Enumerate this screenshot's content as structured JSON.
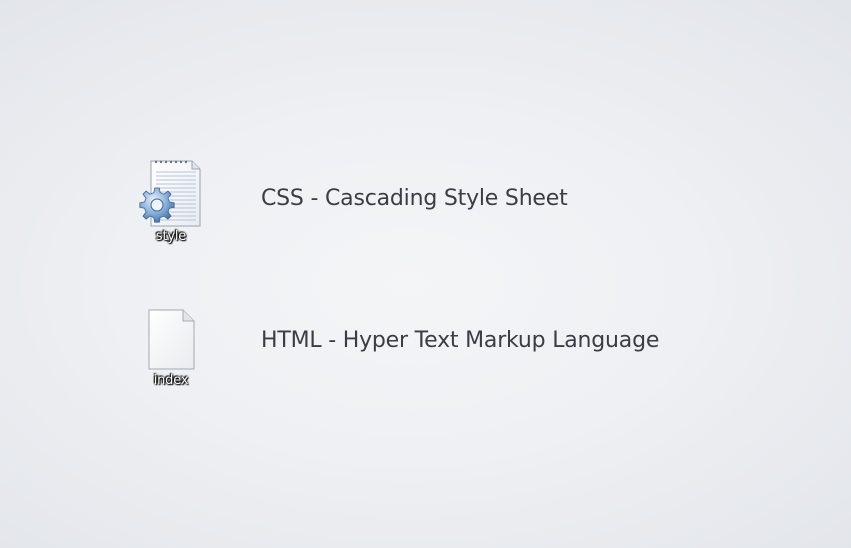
{
  "desktop": {
    "files": [
      {
        "name": "style",
        "icon": "css-file-gear-icon"
      },
      {
        "name": "index",
        "icon": "blank-file-icon"
      }
    ],
    "captions": [
      "CSS - Cascading Style Sheet",
      "HTML - Hyper Text Markup Language"
    ]
  }
}
